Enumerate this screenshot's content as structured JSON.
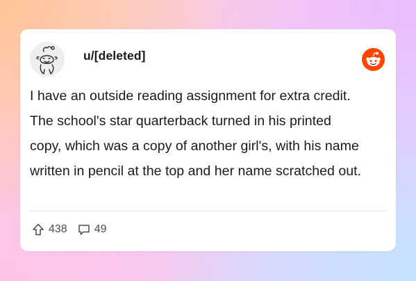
{
  "post": {
    "username": "u/[deleted]",
    "body_lines": [
      "I have an outside reading assignment for extra credit.",
      "The school's star quarterback turned in his printed",
      "copy, which was a copy of another girl's, with his name",
      "written in pencil at the top and her name scratched out."
    ],
    "upvotes": "438",
    "comments": "49"
  },
  "icons": {
    "avatar": "snoo-avatar-icon",
    "logo": "reddit-logo-icon",
    "upvote": "upvote-arrow-icon",
    "comment": "comment-bubble-icon"
  },
  "colors": {
    "brand": "#FF4500",
    "text": "#1A1A1B",
    "card": "#FFFFFF",
    "muted": "#4A4A4F"
  }
}
